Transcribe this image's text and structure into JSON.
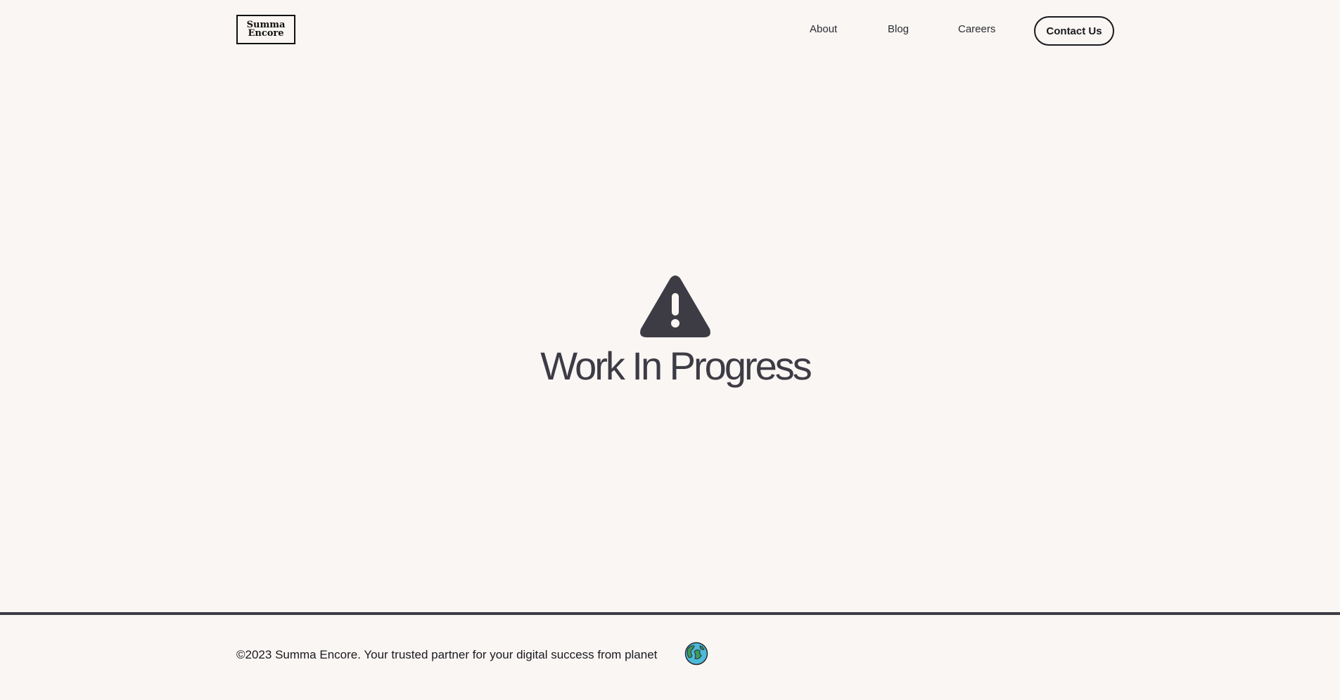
{
  "header": {
    "logo_line1": "Summa",
    "logo_line2": "Encore",
    "nav": {
      "about": "About",
      "blog": "Blog",
      "careers": "Careers"
    },
    "contact_label": "Contact Us"
  },
  "main": {
    "icon": "warning-triangle-icon",
    "title": "Work In Progress"
  },
  "footer": {
    "copyright": "©2023 Summa Encore. Your trusted partner for your digital success from planet",
    "planet_icon": "earth-icon"
  },
  "colors": {
    "background": "#f9f6f3",
    "text_dark": "#1a1a1f",
    "accent_gray": "#3d3c45",
    "earth_blue": "#4dbad9",
    "earth_green": "#3f9a5c"
  }
}
